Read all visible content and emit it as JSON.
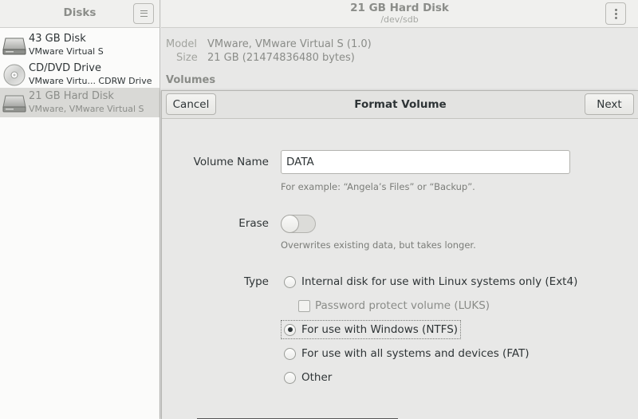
{
  "sidebar": {
    "title": "Disks",
    "disks": [
      {
        "name": "43 GB Disk",
        "sub": "VMware Virtual S",
        "icon": "hard-disk-icon"
      },
      {
        "name": "CD/DVD Drive",
        "sub": "VMware Virtu... CDRW Drive",
        "icon": "optical-disc-icon"
      },
      {
        "name": "21 GB Hard Disk",
        "sub": "VMware, VMware Virtual S",
        "icon": "hard-disk-icon",
        "selected": true
      }
    ]
  },
  "header": {
    "title": "21 GB Hard Disk",
    "subtitle": "/dev/sdb"
  },
  "info": {
    "model_label": "Model",
    "model_value": "VMware, VMware Virtual S (1.0)",
    "size_label": "Size",
    "size_value": "21 GB (21474836480 bytes)",
    "volumes_heading": "Volumes"
  },
  "dialog": {
    "title": "Format Volume",
    "cancel_label": "Cancel",
    "next_label": "Next",
    "volume_name_label": "Volume Name",
    "volume_name_value": "DATA",
    "volume_name_hint": "For example: “Angela’s Files” or “Backup”.",
    "erase_label": "Erase",
    "erase_on": false,
    "erase_hint": "Overwrites existing data, but takes longer.",
    "type_label": "Type",
    "type_options": [
      {
        "label": "Internal disk for use with Linux systems only (Ext4)",
        "checked": false
      },
      {
        "label": "For use with Windows (NTFS)",
        "checked": true
      },
      {
        "label": "For use with all systems and devices (FAT)",
        "checked": false
      },
      {
        "label": "Other",
        "checked": false
      }
    ],
    "luks_label": "Password protect volume (LUKS)",
    "luks_checked": false
  }
}
